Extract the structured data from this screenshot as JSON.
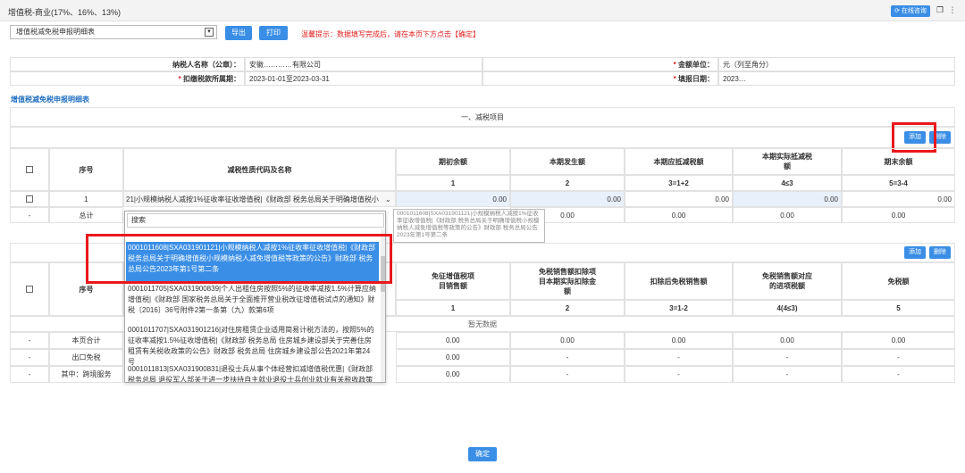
{
  "window": {
    "title": "增值税-商业(17%、16%、13%)",
    "online_query": "在线咨询"
  },
  "toolbar": {
    "report_select": "增值税减免税申报明细表",
    "export": "导出",
    "print": "打印",
    "hint": "温馨提示：数据填写完成后，请在本页下方点击【确定】"
  },
  "info": {
    "taxpayer_label": "纳税人名称（公章）：",
    "taxpayer_value": "安徽…………有限公司",
    "amount_unit_label": "金额单位：",
    "amount_unit_value": "元（列至角分）",
    "period_label": "扣缴税款所属期：",
    "period_value": "2023-01-01至2023-03-31",
    "fill_date_label": "填报日期：",
    "fill_date_value": "2023…"
  },
  "section": {
    "title": "增值税减免税申报明细表",
    "part1": "一、减税项目",
    "add": "添加",
    "delete": "删除"
  },
  "table1": {
    "headers": {
      "seq": "序号",
      "code": "减税性质代码及名称",
      "c1": "期初余额",
      "c2": "本期发生额",
      "c3": "本期应抵减税额",
      "c4": "本期实际抵减税额",
      "c5": "期末余额"
    },
    "index_row": [
      "1",
      "2",
      "3=1+2",
      "4≤3",
      "5=3-4"
    ],
    "row1": {
      "seq": "1",
      "code": "21|小规模纳税人减按1%征收率征收增值税|《财政部 税务总局关于明确增值税小",
      "v": [
        "0.00",
        "0.00",
        "0.00",
        "0.00",
        "0.00"
      ]
    },
    "total": {
      "dash": "-",
      "label": "总计",
      "v": [
        "0.00",
        "0.00",
        "0.00",
        "0.00"
      ]
    }
  },
  "table2": {
    "add": "添加",
    "delete": "删除",
    "headers": {
      "seq": "序号",
      "c1": "免征增值税项目销售额",
      "c2": "免税销售额扣除项目本期实际扣除金额",
      "c3": "扣除后免税销售额",
      "c4": "免税销售额对应的进项税额",
      "c5": "免税额"
    },
    "index_row": [
      "1",
      "2",
      "3=1-2",
      "4(4≤3)",
      "5"
    ],
    "empty": "暂无数据",
    "rows": [
      {
        "dash": "-",
        "label": "本页合计",
        "v": [
          "0.00",
          "0.00",
          "0.00",
          "0.00",
          "0.00"
        ]
      },
      {
        "dash": "-",
        "label": "出口免税",
        "v": [
          "0.00",
          "-",
          "-",
          "-",
          "-"
        ]
      },
      {
        "dash": "-",
        "label": "其中：跨境服务",
        "v": [
          "0.00",
          "-",
          "-",
          "-",
          "-"
        ]
      }
    ]
  },
  "dropdown": {
    "search": "搜索",
    "items": [
      "0001011608|SXA031901121|小规模纳税人减按1%征收率征收增值税|《财政部 税务总局关于明确增值税小规模纳税人减免增值税等政策的公告》财政部 税务总局公告2023年第1号第二条",
      "0001011705|SXA031900839|个人出租住房按照5%的征收率减按1.5%计算应纳增值税|《财政部 国家税务总局关于全面推开营业税改征增值税试点的通知》财税〔2016〕36号附件2第一条第（九）款第6项",
      "0001011707|SXA031901216|对住房租赁企业适用简易计税方法的，按照5%的征收率减按1.5%征收增值税|《财政部 税务总局 住房城乡建设部关于完善住房租赁有关税收政策的公告》财政部 税务总局 住房城乡建设部公告2021年第24号",
      "0001011813|SXA031900831|退役士兵从事个体经营扣减增值税优惠|《财政部 税务总局 退役军人部关于进一步扶持自主就业退役士兵创业就业有关税收政策"
    ]
  },
  "tooltip": "0001011608|SXA031901121|小规模纳税人减按1%征收率征收增值税|《财政部 税务总局关于明确增值税小规模纳税人减免增值税等政策的公告》财政部 税务总局公告2023年第1号第二条",
  "footer": {
    "confirm": "确定"
  }
}
